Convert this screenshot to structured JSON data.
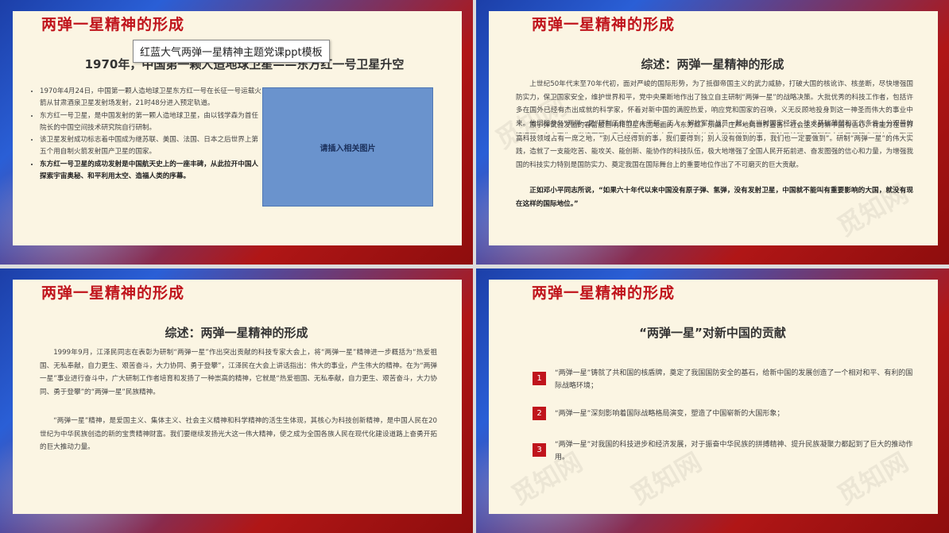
{
  "tooltip": "红蓝大气两弹一星精神主题党课ppt模板",
  "watermark": "觅知网",
  "slide1": {
    "title": "两弹一星精神的形成",
    "subtitle": "1970年，中国第一颗人造地球卫星——东方红一号卫星升空",
    "bullets": [
      "1970年4月24日，中国第一颗人造地球卫星东方红一号在长征一号运载火箭从甘肃酒泉卫星发射场发射，21时48分进入预定轨道。",
      "东方红一号卫星，是中国发射的第一颗人造地球卫星，由以钱学森为首任院长的中国空间技术研究院自行研制。",
      "该卫星发射成功标志着中国成为继苏联、美国、法国、日本之后世界上第五个用自制火箭发射国产卫星的国家。",
      "东方红一号卫星的成功发射是中国航天史上的一座丰碑，从此拉开中国人探索宇宙奥秘、和平利用太空、造福人类的序幕。"
    ],
    "image_placeholder": "请插入相关图片"
  },
  "slide2": {
    "title": "两弹一星精神的形成",
    "subtitle": "综述：两弹一星精神的形成",
    "p1": "上世纪50年代末至70年代初，面对严峻的国际形势，为了抵御帝国主义的武力威胁，打破大国的核讹诈、核垄断，尽快增强国防实力，保卫国家安全，维护世界和平，党中央果断地作出了独立自主研制“两弹一星”的战略决策。大批优秀的科技工作者，包括许多在国外已经有杰出成就的科学家，怀着对新中国的满腔热爱，响应党和国家的召唤，义无反顾地投身到这一神圣而伟大的事业中来。他们和参与“两弹一星”研制工作的广大干部、工人、解放军指战员一起，在当时国家经济、技术基础薄弱和工作条件十分艰苦的情况下，自力更生，发愤图强，完全依靠自己的力量，用较少的投入和较短的时间，突破了核弹、导弹和人造卫星等尖端技术，取得了举世瞩目的辉煌成就。",
    "p2": "原子弹试验发出的春雷般巨响和卫星传回地面的《东方红》乐曲，庄严地向世界宣告：社会主义的新中国有信心、有能力在世界高科技领域占有一席之地，“别人已经得到的事，我们要得到；别人没有做到的事，我们也一定要做到”。研制“两弹一星”的伟大实践，造就了一支能吃苦、能攻关、能创新、能协作的科技队伍，极大地增强了全国人民开拓前进、奋发图强的信心和力量，为增强我国的科技实力特别是国防实力、奠定我国在国际舞台上的重要地位作出了不可磨灭的巨大贡献。",
    "p3": "正如邓小平同志所说，“如果六十年代以来中国没有原子弹、氢弹，没有发射卫星，中国就不能叫有重要影响的大国，就没有现在这样的国际地位。”"
  },
  "slide3": {
    "title": "两弹一星精神的形成",
    "subtitle": "综述：两弹一星精神的形成",
    "p1": "1999年9月，江泽民同志在表彰为研制“两弹一星”作出突出贡献的科技专家大会上，将“两弹一星”精神进一步概括为“热爱祖国、无私奉献，自力更生、艰苦奋斗，大力协同、勇于登攀”，江泽民在大会上讲话指出：伟大的事业，产生伟大的精神。在为“两弹一星”事业进行奋斗中，广大研制工作者培育和发扬了一种崇高的精神，它就是“热爱祖国、无私奉献，自力更生、艰苦奋斗，大力协同、勇于登攀”的“两弹一星”民族精神。",
    "p2": "“两弹一星”精神，是爱国主义、集体主义、社会主义精神和科学精神的活生生体现，其核心为科技创新精神，是中国人民在20世纪为中华民族创造的新的宝贵精神财富。我们要继续发扬光大这一伟大精神，使之成为全国各族人民在现代化建设道路上奋勇开拓的巨大推动力量。"
  },
  "slide4": {
    "title": "两弹一星精神的形成",
    "subtitle": "“两弹一星”对新中国的贡献",
    "items": [
      {
        "num": "1",
        "text": "“两弹一星”铸就了共和国的核盾牌，奠定了我国国防安全的基石，给新中国的发展创造了一个相对和平、有利的国际战略环境；"
      },
      {
        "num": "2",
        "text": "“两弹一星”深刻影响着国际战略格局演变，塑造了中国崭新的大国形象；"
      },
      {
        "num": "3",
        "text": "“两弹一星”对我国的科技进步和经济发展，对于振奋中华民族的拼搏精神、提升民族凝聚力都起到了巨大的推动作用。"
      }
    ]
  }
}
